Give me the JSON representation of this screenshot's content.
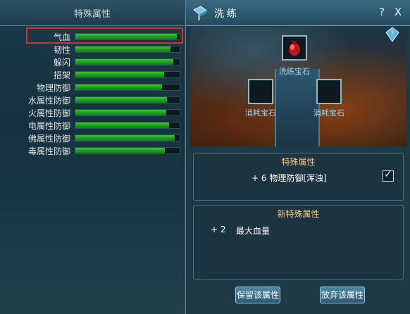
{
  "left_panel": {
    "title": "特殊属性",
    "stats": [
      {
        "label": "气血",
        "fill": 0.97
      },
      {
        "label": "韧性",
        "fill": 0.91
      },
      {
        "label": "躲闪",
        "fill": 0.94
      },
      {
        "label": "招架",
        "fill": 0.85
      },
      {
        "label": "物理防御",
        "fill": 0.83
      },
      {
        "label": "水属性防御",
        "fill": 0.88
      },
      {
        "label": "火属性防御",
        "fill": 0.87
      },
      {
        "label": "电属性防御",
        "fill": 0.9
      },
      {
        "label": "佛属性防御",
        "fill": 0.95
      },
      {
        "label": "毒属性防御",
        "fill": 0.86
      }
    ]
  },
  "dialog": {
    "title": "洗练",
    "help_label": "?",
    "close_label": "X",
    "refine_gem_label": "洗练宝石",
    "consume_gem_left_label": "消耗宝石",
    "consume_gem_right_label": "消耗宝石",
    "special_attr": {
      "title": "特殊属性",
      "line": "+ 6  物理防御[浑浊]",
      "checked": true
    },
    "new_special_attr": {
      "title": "新特殊属性",
      "value": "+ 2",
      "name": "最大血量"
    },
    "keep_button": "保留该属性",
    "discard_button": "放弃该属性"
  },
  "colors": {
    "bar_green": "#2fb533",
    "highlight_red": "#d3322f",
    "title_gold": "#f0c58a",
    "slot_label_blue": "#9fd0ea"
  },
  "icons": {
    "header": "refine-hammer-icon",
    "help": "question-icon",
    "close": "close-icon",
    "refine_gem": "red-gem-icon",
    "gem_help": "gem-question-icon",
    "check": "check-icon"
  }
}
